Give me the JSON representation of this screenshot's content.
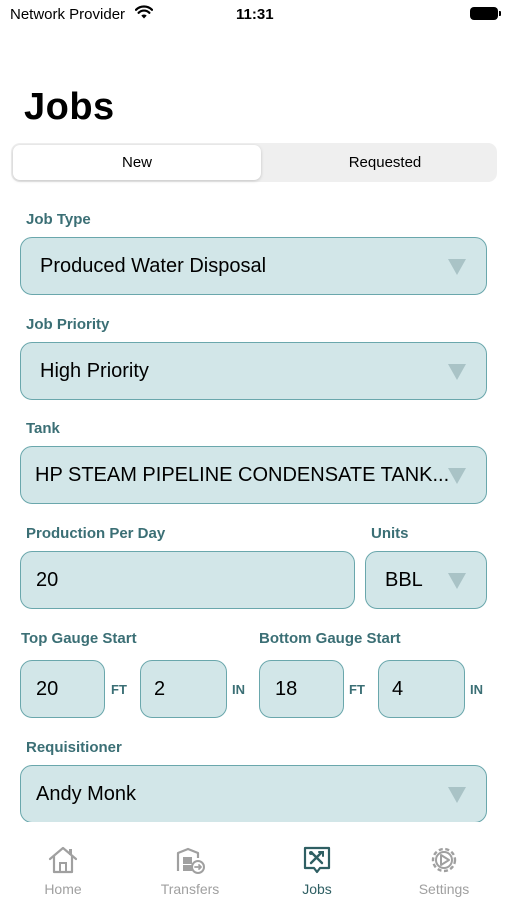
{
  "status_bar": {
    "carrier": "Network Provider",
    "time": "11:31"
  },
  "header": {
    "title": "Jobs"
  },
  "segments": {
    "new": "New",
    "requested": "Requested"
  },
  "form": {
    "job_type": {
      "label": "Job Type",
      "value": "Produced Water Disposal"
    },
    "job_priority": {
      "label": "Job Priority",
      "value": "High Priority"
    },
    "tank": {
      "label": "Tank",
      "value": "HP STEAM PIPELINE CONDENSATE TANK..."
    },
    "production": {
      "label": "Production Per Day",
      "value": "20"
    },
    "units": {
      "label": "Units",
      "value": "BBL"
    },
    "top_gauge": {
      "label": "Top Gauge Start",
      "ft": "20",
      "in": "2"
    },
    "bottom_gauge": {
      "label": "Bottom Gauge Start",
      "ft": "18",
      "in": "4"
    },
    "unit_labels": {
      "ft": "FT",
      "in": "IN"
    },
    "requisitioner": {
      "label": "Requisitioner",
      "value": "Andy Monk"
    }
  },
  "tabbar": {
    "home": {
      "label": "Home",
      "icon": "home-icon"
    },
    "transfers": {
      "label": "Transfers",
      "icon": "transfers-icon"
    },
    "jobs": {
      "label": "Jobs",
      "icon": "jobs-icon"
    },
    "settings": {
      "label": "Settings",
      "icon": "settings-icon"
    }
  },
  "colors": {
    "accent": "#3b6f75",
    "field_bg": "#d2e6e8",
    "field_border": "#6aa7ac",
    "inactive_tab": "#a0a0a0"
  }
}
